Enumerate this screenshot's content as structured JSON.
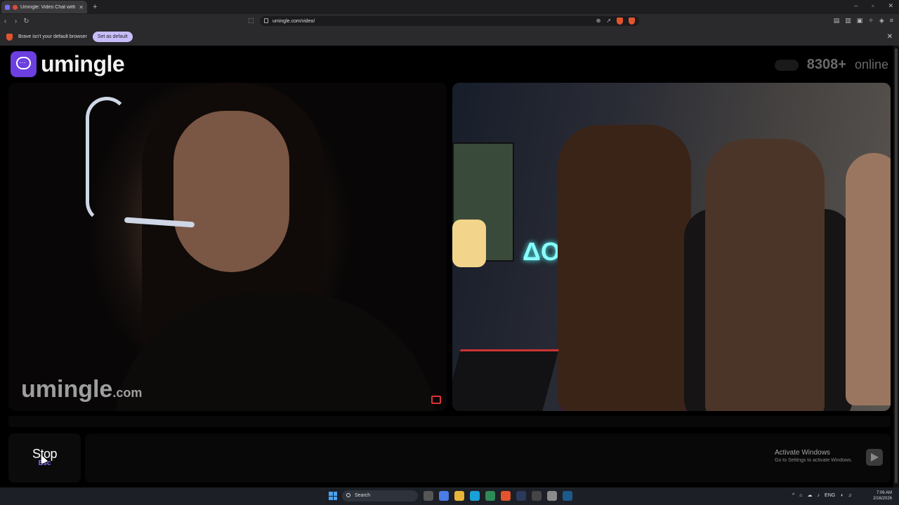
{
  "browser": {
    "tab_title": "Umingle: Video Chat with Str",
    "url": "umingle.com/video/",
    "infobar_message": "Brave isn't your default browser",
    "set_default_label": "Set as default"
  },
  "site": {
    "logo_text": "umingle",
    "online_count": "8308+",
    "online_label": "online",
    "watermark_main": "umingle",
    "watermark_tld": ".com"
  },
  "controls": {
    "stop_label": "Stop",
    "stop_key": "Esc",
    "message_value": ""
  },
  "windows_notice": {
    "title": "Activate Windows",
    "subtitle": "Go to Settings to activate Windows."
  },
  "taskbar": {
    "search_label": "Search",
    "language": "ENG",
    "time": "7:06 AM",
    "date": "2/16/2026"
  },
  "colors": {
    "accent": "#6b3fe0",
    "stop_key": "#8c6df5",
    "brave": "#e2542c"
  }
}
